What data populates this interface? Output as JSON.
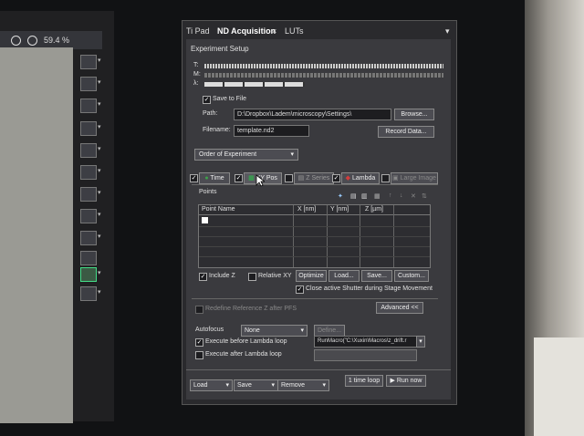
{
  "left_window": {
    "zoom": "59.4 %"
  },
  "panel": {
    "tabs": [
      "Ti Pad",
      "ND Acquisition",
      "LUTs"
    ],
    "close": "×",
    "section_title": "Experiment Setup",
    "time_labels": [
      "T:",
      "M:",
      "λ:"
    ],
    "save_to_file": "Save to File",
    "path_label": "Path:",
    "path_value": "D:\\Dropbox\\Ladem\\microscopy\\Settings\\",
    "browse": "Browse...",
    "filename_label": "Filename:",
    "filename_value": "template.nd2",
    "record_data": "Record Data...",
    "order": "Order of Experiment",
    "dim_tabs": {
      "time": "Time",
      "xypos": "XY Pos",
      "zseries": "Z Series",
      "lambda": "Lambda",
      "large_image": "Large Image"
    },
    "points_title": "Points",
    "columns": [
      "Point Name",
      "X [nm]",
      "Y [nm]",
      "Z [µm]"
    ],
    "include_z": "Include Z",
    "relative_xy": "Relative XY",
    "optimize": "Optimize",
    "load_pts": "Load...",
    "save_pts": "Save...",
    "custom": "Custom...",
    "close_shutter": "Close active Shutter during Stage Movement",
    "redefine": "Redefine Reference Z after PFS",
    "advanced": "Advanced <<",
    "autofocus_label": "Autofocus",
    "autofocus_value": "None",
    "define": "Define...",
    "exec_before": "Execute before Lambda loop",
    "exec_after": "Execute after Lambda loop",
    "macro_value": "RunMacro(\"C:\\Xuxin\\Macros\\z_drift.r",
    "load": "Load",
    "save": "Save",
    "remove": "Remove",
    "one_time_loop": "1 time loop",
    "run_now": "Run now"
  },
  "colors": {
    "time_green": "#3da34a",
    "xy_green": "#2eb84a",
    "lambda_multi": "#d43c3c"
  }
}
